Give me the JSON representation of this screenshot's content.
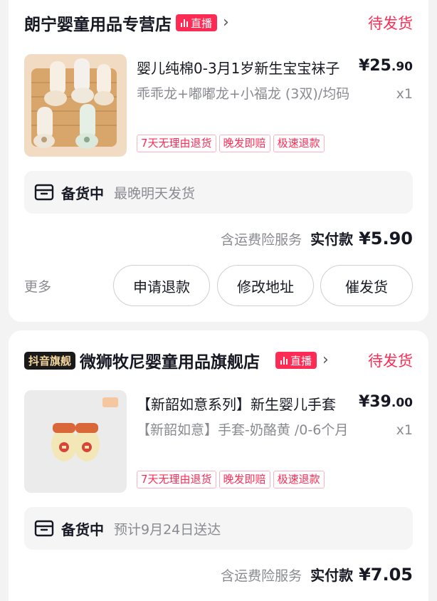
{
  "orders": [
    {
      "shop_name": "朗宁婴童用品专营店",
      "flag_badge": "",
      "live_label": "直播",
      "status": "待发货",
      "product": {
        "title": "婴儿纯棉0-3月1岁新生宝宝袜子",
        "price_int": "¥25",
        "price_dec": ".90",
        "spec": "乖乖龙+嘟嘟龙+小福龙 (3双)/均码",
        "qty": "x1",
        "tags": [
          "7天无理由退货",
          "晚发即赔",
          "极速退款"
        ]
      },
      "stock_label": "备货中",
      "stock_text": "最晚明天发货",
      "insurance": "含运费险服务",
      "paid_label": "实付款",
      "paid_amount": "¥5.90",
      "more": "更多",
      "buttons": {
        "refund": "申请退款",
        "address": "修改地址",
        "urge": "催发货"
      }
    },
    {
      "shop_name": "微狮牧尼婴童用品旗舰店",
      "flag_badge": "抖音旗舰",
      "live_label": "直播",
      "status": "待发货",
      "product": {
        "title": "【新韶如意系列】新生婴儿手套",
        "price_int": "¥39",
        "price_dec": ".00",
        "spec": "【新韶如意】手套-奶酪黄 /0-6个月",
        "qty": "x1",
        "tags": [
          "7天无理由退货",
          "晚发即赔",
          "极速退款"
        ]
      },
      "stock_label": "备货中",
      "stock_text": "预计9月24日送达",
      "insurance": "含运费险服务",
      "paid_label": "实付款",
      "paid_amount": "¥7.05"
    }
  ],
  "colors": {
    "accent": "#fe2c55",
    "text": "#161823",
    "muted": "#8a8b91"
  },
  "icons": [
    "live-bars-icon",
    "chevron-right-icon",
    "package-icon"
  ]
}
